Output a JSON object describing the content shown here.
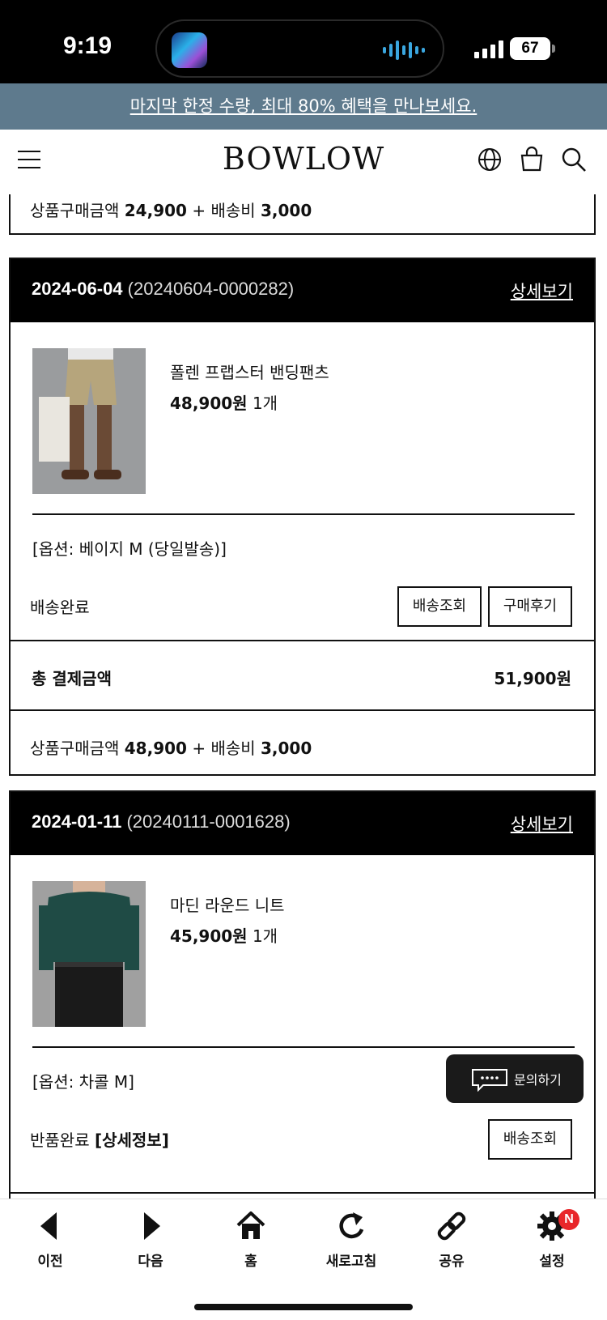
{
  "status_bar": {
    "time": "9:19",
    "battery": "67"
  },
  "promo": {
    "text": "마지막 한정 수량, 최대 80% 혜택을 만나보세요."
  },
  "header": {
    "logo": "BOWLOW"
  },
  "summary_top": {
    "label": "상품구매금액",
    "product_amount": "24,900",
    "plus": "+",
    "shipping_label": "배송비",
    "shipping_amount": "3,000"
  },
  "orders": [
    {
      "date": "2024-06-04",
      "order_no": "(20240604-0000282)",
      "detail_link": "상세보기",
      "product_name": "폴렌 프랩스터 밴딩팬츠",
      "price": "48,900원",
      "qty": "1개",
      "option": "[옵션: 베이지 M (당일발송)]",
      "status": "배송완료",
      "btn_track": "배송조회",
      "btn_review": "구매후기",
      "total_label": "총 결제금액",
      "total_value": "51,900원",
      "summary_label": "상품구매금액",
      "summary_product": "48,900",
      "summary_plus": "+",
      "summary_shipping_label": "배송비",
      "summary_shipping": "3,000"
    },
    {
      "date": "2024-01-11",
      "order_no": "(20240111-0001628)",
      "detail_link": "상세보기",
      "product_name": "마딘 라운드 니트",
      "price": "45,900원",
      "qty": "1개",
      "option": "[옵션: 차콜 M]",
      "status": "반품완료",
      "status_detail": "[상세정보]",
      "btn_track": "배송조회"
    }
  ],
  "inquiry": {
    "label": "문의하기"
  },
  "toolbar": {
    "items": [
      {
        "label": "이전",
        "icon": "back-icon"
      },
      {
        "label": "다음",
        "icon": "forward-icon"
      },
      {
        "label": "홈",
        "icon": "home-icon"
      },
      {
        "label": "새로고침",
        "icon": "refresh-icon"
      },
      {
        "label": "공유",
        "icon": "share-icon"
      },
      {
        "label": "설정",
        "icon": "settings-icon",
        "badge": "N"
      }
    ]
  },
  "colors": {
    "promo_bg": "#5e7a8d",
    "order_header_bg": "#000000",
    "badge": "#e8262a"
  }
}
